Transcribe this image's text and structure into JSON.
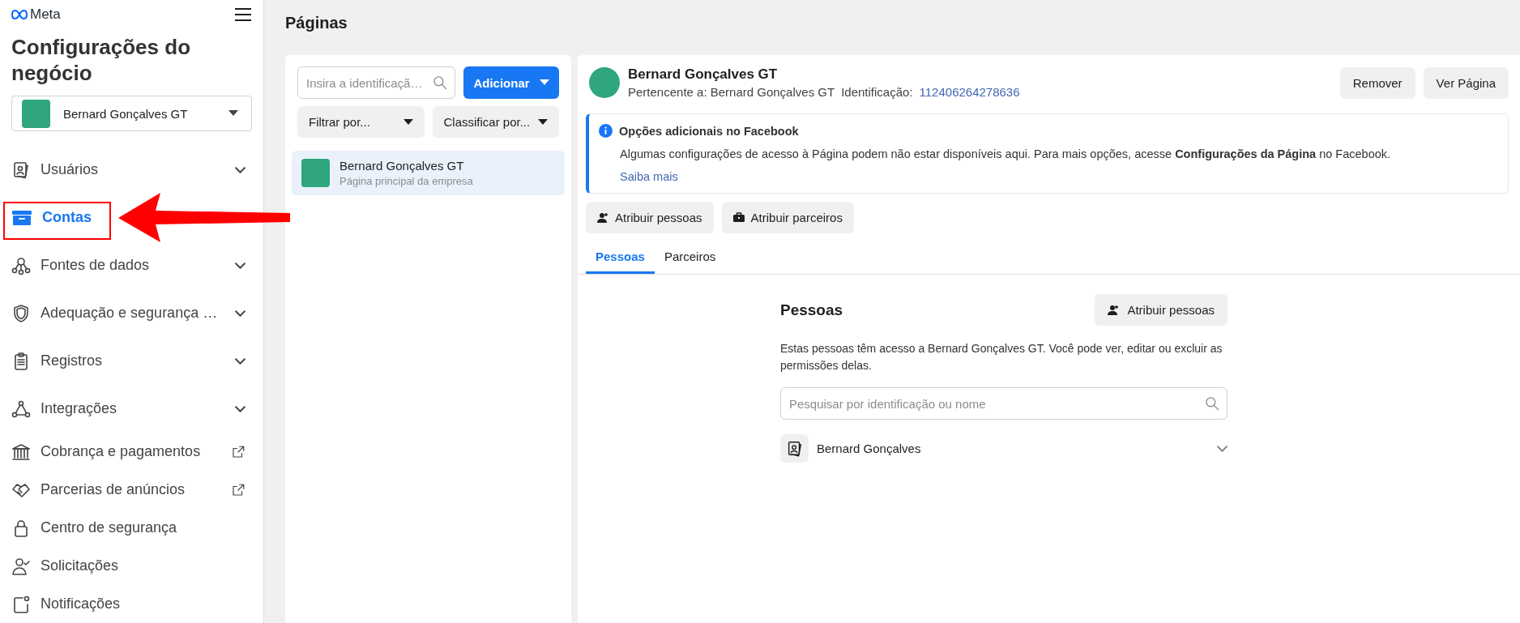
{
  "sidebar": {
    "logo": "Meta",
    "title": "Configurações do negócio",
    "business": {
      "name": "Bernard Gonçalves GT"
    },
    "items": [
      {
        "label": "Usuários",
        "kind": "expandable",
        "selected": false
      },
      {
        "label": "Contas",
        "kind": "plain",
        "selected": true
      },
      {
        "label": "Fontes de dados",
        "kind": "expandable",
        "selected": false
      },
      {
        "label": "Adequação e segurança …",
        "kind": "expandable",
        "selected": false
      },
      {
        "label": "Registros",
        "kind": "expandable",
        "selected": false
      },
      {
        "label": "Integrações",
        "kind": "expandable",
        "selected": false
      },
      {
        "label": "Cobrança e pagamentos",
        "kind": "external",
        "selected": false
      },
      {
        "label": "Parcerias de anúncios",
        "kind": "external",
        "selected": false
      },
      {
        "label": "Centro de segurança",
        "kind": "plain",
        "selected": false
      },
      {
        "label": "Solicitações",
        "kind": "plain",
        "selected": false
      },
      {
        "label": "Notificações",
        "kind": "plain",
        "selected": false
      }
    ]
  },
  "page_title": "Páginas",
  "list_panel": {
    "search": {
      "placeholder": "Insira a identificaçã…"
    },
    "add_button": "Adicionar",
    "filter": "Filtrar por...",
    "sort": "Classificar por...",
    "items": [
      {
        "name": "Bernard Gonçalves GT",
        "subtitle": "Página principal da empresa",
        "selected": true
      }
    ]
  },
  "detail": {
    "name": "Bernard Gonçalves GT",
    "owner": "Pertencente a: Bernard Gonçalves GT",
    "id_label": "Identificação:",
    "id_value": "112406264278636",
    "buttons": [
      "Remover",
      "Ver Página"
    ],
    "notice": {
      "title": "Opções adicionais no Facebook",
      "text": "Algumas configurações de acesso à Página podem não estar disponíveis aqui. Para mais opções, acesse **Configurações da Página** no Facebook.",
      "link": "Saiba mais"
    },
    "actions": [
      "Atribuir pessoas",
      "Atribuir parceiros"
    ],
    "tabs": [
      {
        "label": "Pessoas",
        "selected": true
      },
      {
        "label": "Parceiros",
        "selected": false
      }
    ],
    "people": {
      "title": "Pessoas",
      "assign_button": "Atribuir pessoas",
      "description": "Estas pessoas têm acesso a Bernard Gonçalves GT. Você pode ver, editar ou excluir as permissões delas.",
      "search": {
        "placeholder": "Pesquisar por identificação ou nome"
      },
      "rows": [
        {
          "name": "Bernard Gonçalves",
          "expanded": false
        }
      ]
    }
  }
}
